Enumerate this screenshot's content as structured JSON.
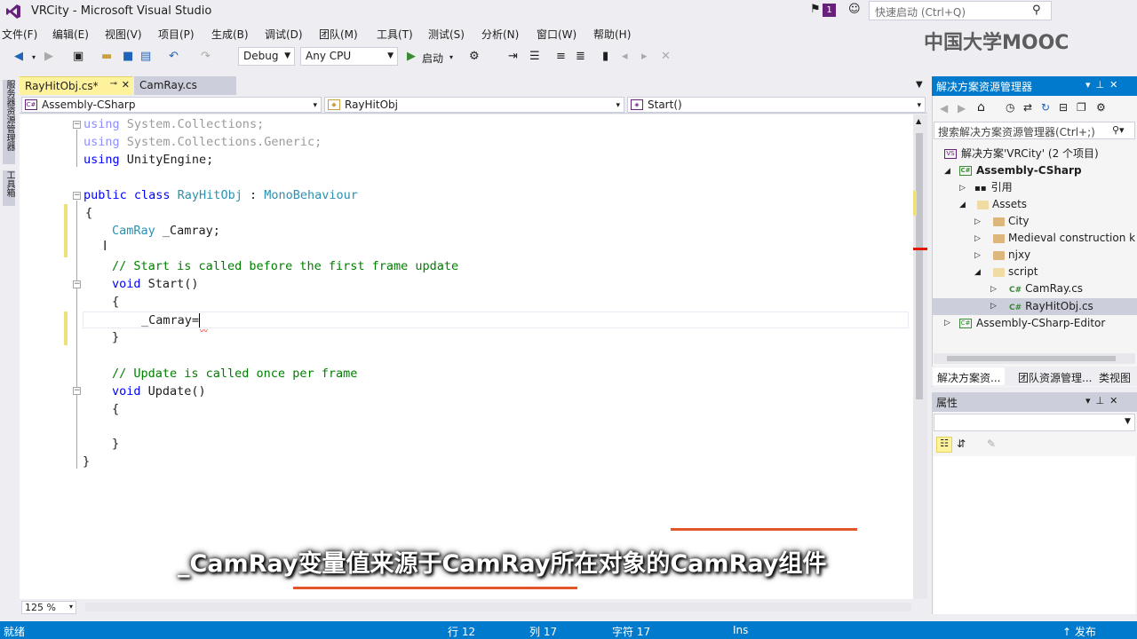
{
  "window": {
    "title": "VRCity - Microsoft Visual Studio",
    "notifications": "1",
    "quick_launch_placeholder": "快速启动 (Ctrl+Q)"
  },
  "watermark": "中国大学MOOC",
  "menu": [
    "文件(F)",
    "编辑(E)",
    "视图(V)",
    "项目(P)",
    "生成(B)",
    "调试(D)",
    "团队(M)",
    "工具(T)",
    "测试(S)",
    "分析(N)",
    "窗口(W)",
    "帮助(H)"
  ],
  "toolbar": {
    "configuration": "Debug",
    "platform": "Any CPU",
    "start_label": "启动"
  },
  "left_strip": {
    "tab1": "服务器资源管理器",
    "tab2": "工具箱"
  },
  "doc_tabs": [
    {
      "label": "RayHitObj.cs*",
      "active": true
    },
    {
      "label": "CamRay.cs",
      "active": false
    }
  ],
  "nav": {
    "project": "Assembly-CSharp",
    "class": "RayHitObj",
    "member": "Start()"
  },
  "code": {
    "l1": [
      "using",
      " System.Collections;"
    ],
    "l2": [
      "using",
      " System.Collections.Generic;"
    ],
    "l3": [
      "using",
      " UnityEngine;"
    ],
    "l5": [
      "public class ",
      "RayHitObj",
      " : ",
      "MonoBehaviour"
    ],
    "l6": "{",
    "l7": [
      "CamRay",
      " _Camray;"
    ],
    "l9": "// Start is called before the first frame update",
    "l10": [
      "void",
      " Start()"
    ],
    "l11": "{",
    "l12": "_Camray=",
    "l13": "}",
    "l15": "// Update is called once per frame",
    "l16": [
      "void",
      " Update()"
    ],
    "l17": "{",
    "l19": "}",
    "l20": "}"
  },
  "zoom": "125 %",
  "solution_explorer": {
    "title": "解决方案资源管理器",
    "search_placeholder": "搜索解决方案资源管理器(Ctrl+;)",
    "tree": {
      "solution": "解决方案'VRCity' (2 个项目)",
      "project1": "Assembly-CSharp",
      "references": "引用",
      "assets": "Assets",
      "city": "City",
      "medieval": "Medieval construction k",
      "njxy": "njxy",
      "script": "script",
      "camray": "CamRay.cs",
      "rayhitobj": "RayHitObj.cs",
      "project2": "Assembly-CSharp-Editor"
    },
    "tabs": [
      "解决方案资...",
      "团队资源管理...",
      "类视图"
    ]
  },
  "properties": {
    "title": "属性"
  },
  "subtitle": "_CamRay变量值来源于CamRay所在对象的CamRay组件",
  "status": {
    "ready": "就绪",
    "line": "行 12",
    "col": "列 17",
    "char": "字符 17",
    "mode": "Ins",
    "publish": "↑ 发布"
  },
  "colors": {
    "accent": "#007ACC",
    "brand": "#68217A",
    "keyword": "#0000FF",
    "type": "#2B91AF",
    "comment": "#008000"
  }
}
